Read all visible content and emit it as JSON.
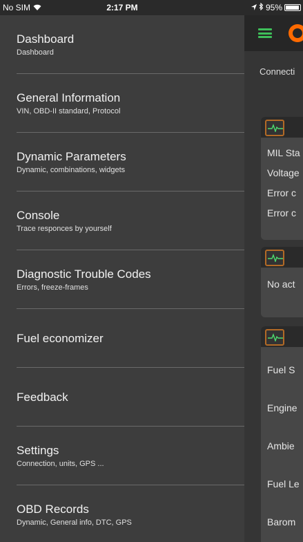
{
  "status": {
    "carrier": "No SIM",
    "time": "2:17 PM",
    "battery": "95%",
    "battery_level": 0.95
  },
  "menu": {
    "items": [
      {
        "title": "Dashboard",
        "sub": "Dashboard"
      },
      {
        "title": "General Information",
        "sub": "VIN, OBD-II standard, Protocol"
      },
      {
        "title": "Dynamic Parameters",
        "sub": "Dynamic, combinations, widgets"
      },
      {
        "title": "Console",
        "sub": "Trace responces by yourself"
      },
      {
        "title": "Diagnostic Trouble Codes",
        "sub": "Errors, freeze-frames"
      },
      {
        "title": "Fuel economizer",
        "sub": ""
      },
      {
        "title": "Feedback",
        "sub": ""
      },
      {
        "title": "Settings",
        "sub": "Connection, units, GPS ..."
      },
      {
        "title": "OBD Records",
        "sub": "Dynamic, General info, DTC, GPS"
      }
    ]
  },
  "app": {
    "connection_label": "Connecti",
    "card1": {
      "rows": [
        "MIL Sta",
        "Voltage",
        "Error c",
        "Error c"
      ]
    },
    "card2": {
      "rows": [
        "No act"
      ]
    },
    "card3": {
      "rows": [
        "Fuel S",
        "Engine",
        "Ambie",
        "Fuel Le",
        "Barom"
      ]
    }
  },
  "colors": {
    "menu_bg": "#3d3d3d",
    "accent_green": "#3fbf5a",
    "logo_orange": "#ff6a00"
  }
}
